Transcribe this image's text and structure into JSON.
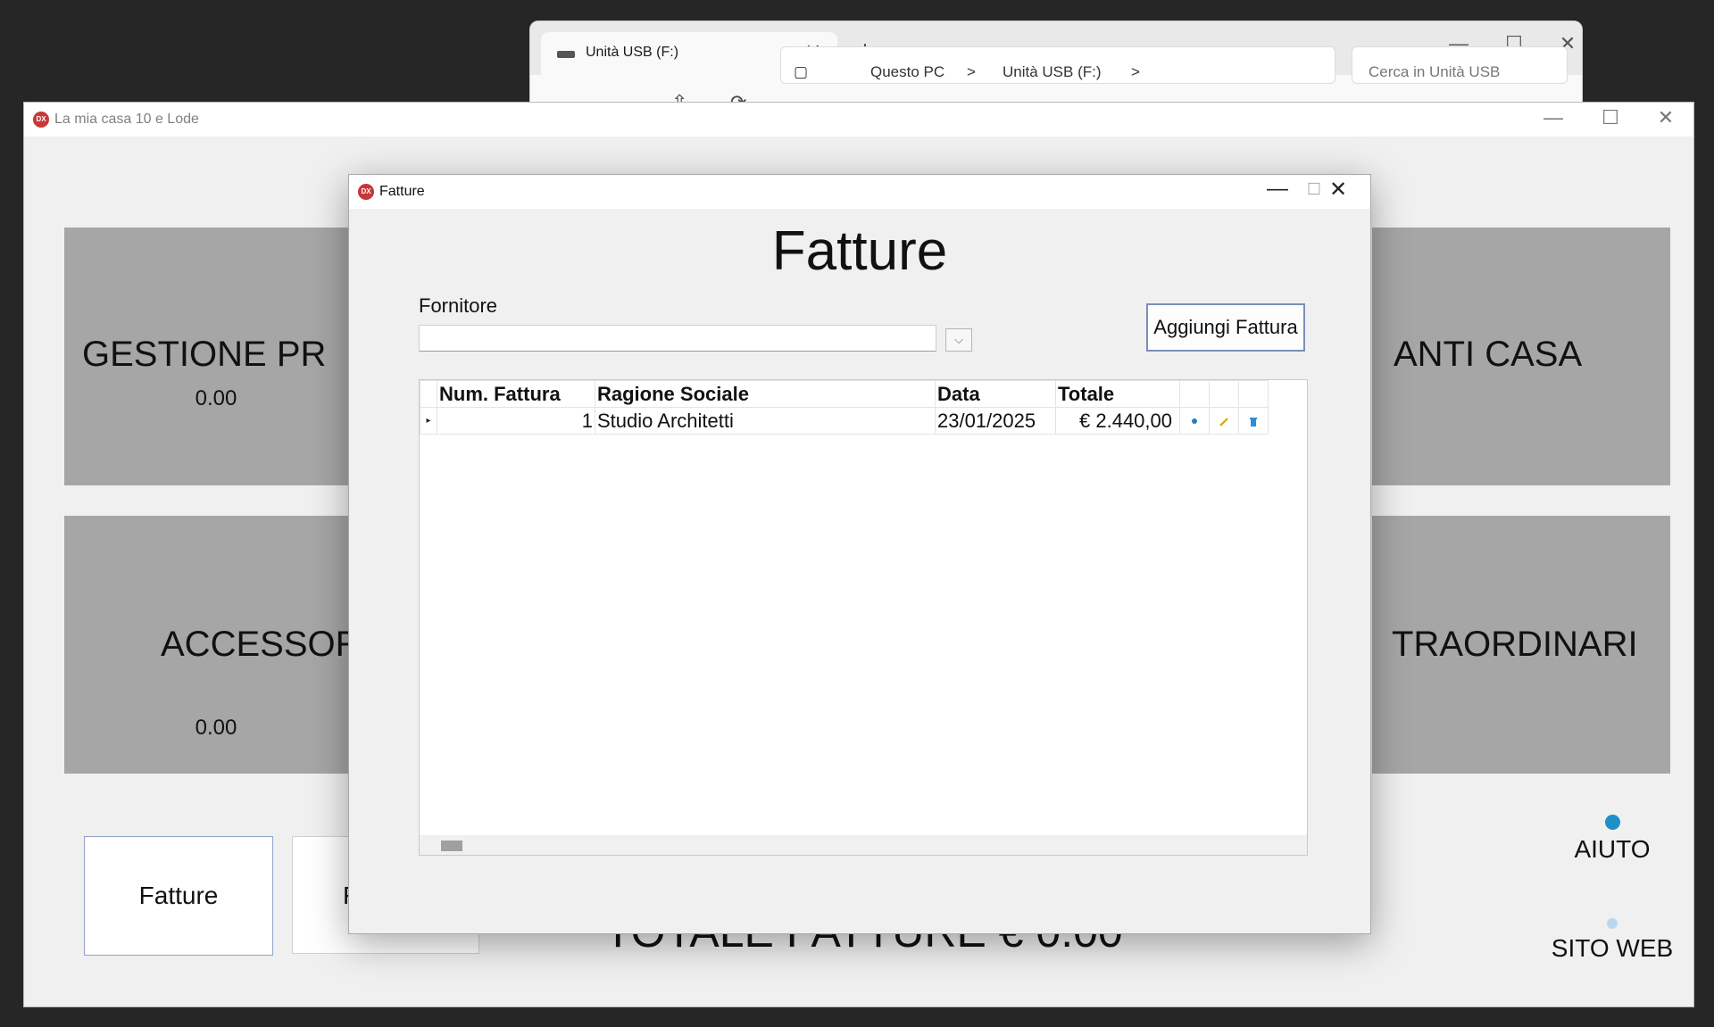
{
  "explorer": {
    "tab_title": "Unità USB (F:)",
    "new_tab": "+",
    "close_tab": "✕",
    "window_controls": [
      "—",
      "☐",
      "✕"
    ],
    "nav_buttons": [
      "←",
      "→",
      "⇧",
      "⟳"
    ],
    "address_parts": [
      "Questo PC",
      ">",
      "Unità USB (F:)",
      ">"
    ],
    "search_placeholder": "Cerca in Unità USB"
  },
  "main_window": {
    "title": "La mia casa 10 e Lode",
    "logo": "DX",
    "controls": [
      "—",
      "☐",
      "✕"
    ],
    "tiles": [
      {
        "label": "GESTIONE PR",
        "value": "0.00"
      },
      {
        "label": "ANTI CASA",
        "value": ""
      },
      {
        "label": "ACCESSORI",
        "value": "0.00"
      },
      {
        "label": "TRAORDINARI",
        "value": ""
      }
    ],
    "bottom_buttons": [
      "Fatture",
      "F"
    ],
    "totale_fatture": "TOTALE FATTURE € 0.00",
    "aiuto": "AIUTO",
    "sito_web": "SITO WEB"
  },
  "dialog": {
    "title": "Fatture",
    "logo": "DX",
    "controls": [
      "—",
      "☐",
      "✕"
    ],
    "heading": "Fatture",
    "fornitore_label": "Fornitore",
    "fornitore_value": "",
    "dropdown_glyph": "⌵",
    "add_button": "Aggiungi Fattura",
    "grid": {
      "columns": [
        "Num. Fattura",
        "Ragione Sociale",
        "Data",
        "Totale"
      ],
      "rows": [
        {
          "indicator": "▸",
          "num": "1",
          "ragione_sociale": "Studio Architetti",
          "data": "23/01/2025",
          "totale": "€ 2.440,00"
        }
      ],
      "row_icons": [
        "view-icon",
        "edit-icon",
        "delete-icon"
      ]
    }
  },
  "colors": {
    "tile_gray": "#a6a6a6",
    "app_background": "#f0f0f0",
    "dx_logo_red": "#c8373a",
    "button_border": "#7a8fb8"
  }
}
